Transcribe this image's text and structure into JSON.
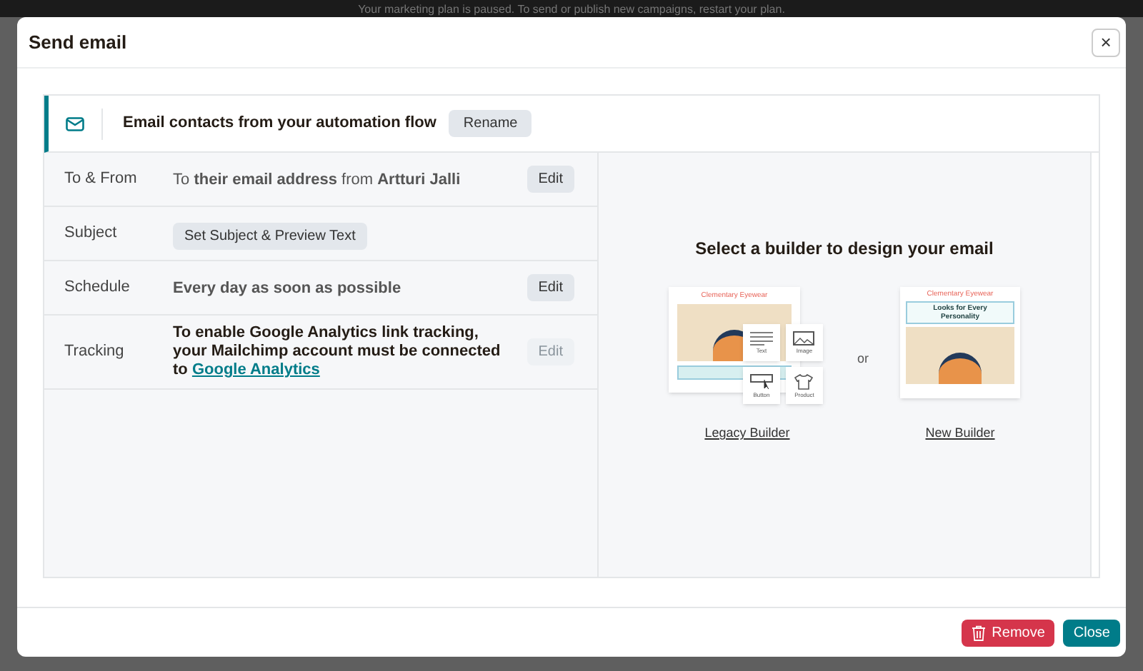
{
  "background": {
    "banner": "Your marketing plan is paused. To send or publish new campaigns, restart your plan."
  },
  "dialog": {
    "title": "Send email",
    "close_icon": "×"
  },
  "email": {
    "name": "Email contacts from your automation flow",
    "rename": "Rename"
  },
  "settings": [
    {
      "label": "To & From",
      "kind": "text",
      "value": "To **their email address** from **Artturi Jalli**",
      "button": "Edit",
      "disabled": false
    },
    {
      "label": "Subject",
      "kind": "action",
      "value": "Set Subject & Preview Text"
    },
    {
      "label": "Schedule",
      "kind": "text",
      "value": "**Every day as soon as possible**",
      "button": "Edit",
      "disabled": false
    },
    {
      "label": "Tracking",
      "kind": "link",
      "value": "To enable Google Analytics link tracking, your Mailchimp account must be connected to",
      "link": "Google Analytics",
      "button": "Edit",
      "disabled": true
    }
  ],
  "builder": {
    "heading": "Select a builder to design your email",
    "separator": "or",
    "legacy": {
      "brand": "Clementary Eyewear",
      "blocks": [
        "Text",
        "Image",
        "Button",
        "Product"
      ],
      "link": "Legacy Builder"
    },
    "new": {
      "brand": "Clementary Eyewear",
      "headline": "Looks for Every Personality",
      "link": "New Builder"
    }
  },
  "footer": {
    "remove": "Remove",
    "close": "Close"
  }
}
